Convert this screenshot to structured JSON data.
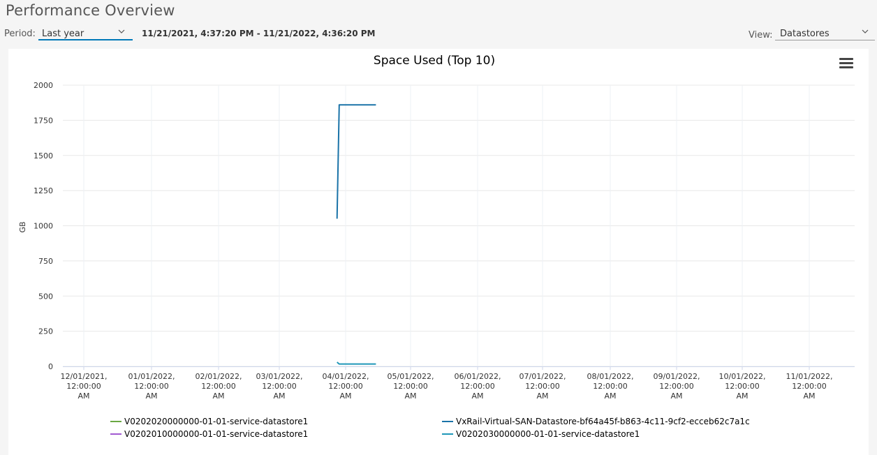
{
  "page": {
    "title": "Performance Overview"
  },
  "controls": {
    "period_label": "Period:",
    "period_value": "Last year",
    "time_range": "11/21/2021, 4:37:20 PM - 11/21/2022, 4:36:20 PM",
    "view_label": "View:",
    "view_value": "Datastores"
  },
  "chart_data": {
    "type": "line",
    "title": "Space Used (Top 10)",
    "ylabel": "GB",
    "xlabel": "",
    "ylim": [
      0,
      2000
    ],
    "yticks": [
      "0",
      "250",
      "500",
      "750",
      "1000",
      "1250",
      "1500",
      "1750",
      "2000"
    ],
    "xticks": [
      [
        "12/01/2021,",
        "12:00:00",
        "AM"
      ],
      [
        "01/01/2022,",
        "12:00:00",
        "AM"
      ],
      [
        "02/01/2022,",
        "12:00:00",
        "AM"
      ],
      [
        "03/01/2022,",
        "12:00:00",
        "AM"
      ],
      [
        "04/01/2022,",
        "12:00:00",
        "AM"
      ],
      [
        "05/01/2022,",
        "12:00:00",
        "AM"
      ],
      [
        "06/01/2022,",
        "12:00:00",
        "AM"
      ],
      [
        "07/01/2022,",
        "12:00:00",
        "AM"
      ],
      [
        "08/01/2022,",
        "12:00:00",
        "AM"
      ],
      [
        "09/01/2022,",
        "12:00:00",
        "AM"
      ],
      [
        "10/01/2022,",
        "12:00:00",
        "AM"
      ],
      [
        "11/01/2022,",
        "12:00:00",
        "AM"
      ]
    ],
    "grid": true,
    "legend_position": "bottom",
    "series": [
      {
        "name": "V0202020000000-01-01-service-datastore1",
        "color": "#6aa843",
        "points": []
      },
      {
        "name": "VxRail-Virtual-SAN-Datastore-bf64a45f-b863-4c11-9cf2-ecceb62c7a1c",
        "color": "#1a73a8",
        "points": [
          {
            "x": "2022-03-28",
            "y": 1050
          },
          {
            "x": "2022-03-29",
            "y": 1860
          },
          {
            "x": "2022-04-15",
            "y": 1860
          }
        ]
      },
      {
        "name": "V0202010000000-01-01-service-datastore1",
        "color": "#a25ad1",
        "points": []
      },
      {
        "name": "V0202030000000-01-01-service-datastore1",
        "color": "#1f97b8",
        "points": [
          {
            "x": "2022-03-28",
            "y": 30
          },
          {
            "x": "2022-03-29",
            "y": 17
          },
          {
            "x": "2022-04-15",
            "y": 17
          }
        ]
      }
    ]
  }
}
